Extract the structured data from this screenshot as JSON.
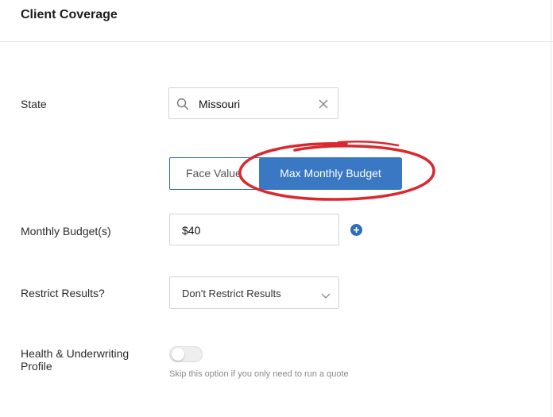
{
  "panel": {
    "title": "Client Coverage"
  },
  "state": {
    "label": "State",
    "value": "Missouri"
  },
  "mode_toggle": {
    "face_value_label": "Face Value",
    "max_budget_label": "Max Monthly Budget"
  },
  "budget": {
    "label": "Monthly Budget(s)",
    "value": "$40"
  },
  "restrict": {
    "label": "Restrict Results?",
    "selected": "Don't Restrict Results"
  },
  "health": {
    "label": "Health & Underwriting Profile",
    "toggle_on": false,
    "help_text": "Skip this option if you only need to run a quote"
  },
  "colors": {
    "accent": "#3a78c4",
    "annotation": "#d9292f"
  },
  "icons": [
    "search-icon",
    "clear-icon",
    "plus-circle-icon",
    "chevron-down-icon"
  ]
}
